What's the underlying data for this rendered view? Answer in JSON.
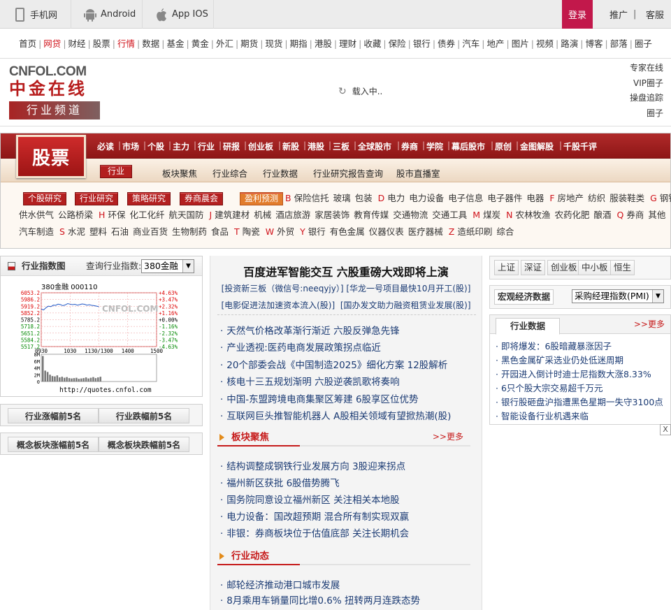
{
  "topbar": {
    "mobile": "手机网",
    "android": "Android",
    "ios": "App IOS",
    "login": "登录",
    "promote": "推广",
    "sep": "|",
    "service": "客服"
  },
  "nav": [
    "首页",
    "网贷",
    "财经",
    "股票",
    "行情",
    "数据",
    "基金",
    "黄金",
    "外汇",
    "期货",
    "现货",
    "期指",
    "港股",
    "理财",
    "收藏",
    "保险",
    "银行",
    "债券",
    "汽车",
    "地产",
    "图片",
    "视频",
    "路演",
    "博客",
    "部落",
    "圈子"
  ],
  "nav_red": [
    1,
    4
  ],
  "header": {
    "logo_top": "CNFOL.COM",
    "logo_mid": "中金在线",
    "logo_bottom": "行业频道",
    "loading": "载入中..",
    "side_links": [
      "专家在线",
      "VIP圈子",
      "操盘追踪",
      "圈子"
    ]
  },
  "band": {
    "title": "股票",
    "categories": [
      "必读",
      "市场",
      "个股",
      "主力",
      "行业",
      "研报",
      "创业板",
      "新股",
      "港股",
      "三板",
      "全球股市",
      "券商",
      "学院",
      "幕后股市",
      "原创",
      "金图解股",
      "千股千评"
    ],
    "active_sub": "行业",
    "subnav": [
      "板块聚焦",
      "行业综合",
      "行业数据",
      "行业研究报告查询",
      "股市直播室"
    ],
    "buttons": [
      "个股研究",
      "行业研究",
      "策略研究",
      "券商晨会"
    ],
    "orange_button": "盈利预测",
    "industry_lines": [
      [
        [
          "B",
          ""
        ],
        [
          "",
          "保险信托"
        ],
        [
          "",
          "玻璃"
        ],
        [
          "",
          "包装"
        ],
        [
          "D",
          ""
        ],
        [
          "",
          "电力"
        ],
        [
          "",
          "电力设备"
        ],
        [
          "",
          "电子信息"
        ],
        [
          "",
          "电子器件"
        ],
        [
          "",
          "电器"
        ],
        [
          "F",
          ""
        ],
        [
          "",
          "房地产"
        ],
        [
          "",
          "纺织"
        ],
        [
          "",
          "服装鞋类"
        ],
        [
          "G",
          ""
        ],
        [
          "",
          "钢铁"
        ]
      ],
      [
        [
          "",
          "供水供气"
        ],
        [
          "",
          "公路桥梁"
        ],
        [
          "H",
          ""
        ],
        [
          "",
          "环保"
        ],
        [
          "",
          "化工化纤"
        ],
        [
          "",
          "航天国防"
        ],
        [
          "J",
          ""
        ],
        [
          "",
          "建筑建材"
        ],
        [
          "",
          "机械"
        ],
        [
          "",
          "酒店旅游"
        ],
        [
          "",
          "家居装饰"
        ],
        [
          "",
          "教育传媒"
        ],
        [
          "",
          "交通物流"
        ],
        [
          "",
          "交通工具"
        ],
        [
          "M",
          ""
        ],
        [
          "",
          "煤炭"
        ],
        [
          "N",
          ""
        ],
        [
          "",
          "农林牧渔"
        ],
        [
          "",
          "农药化肥"
        ],
        [
          "",
          "酿酒"
        ],
        [
          "Q",
          ""
        ],
        [
          "",
          "券商"
        ],
        [
          "",
          "其他"
        ]
      ],
      [
        [
          "",
          "汽车制造"
        ],
        [
          "S",
          ""
        ],
        [
          "",
          "水泥"
        ],
        [
          "",
          "塑料"
        ],
        [
          "",
          "石油"
        ],
        [
          "",
          "商业百货"
        ],
        [
          "",
          "生物制药"
        ],
        [
          "",
          "食品"
        ],
        [
          "T",
          ""
        ],
        [
          "",
          "陶瓷"
        ],
        [
          "W",
          ""
        ],
        [
          "",
          "外贸"
        ],
        [
          "Y",
          ""
        ],
        [
          "",
          "银行"
        ],
        [
          "",
          "有色金属"
        ],
        [
          "",
          "仪器仪表"
        ],
        [
          "",
          "医疗器械"
        ],
        [
          "Z",
          ""
        ],
        [
          "",
          "造纸印刷"
        ],
        [
          "",
          "综合"
        ]
      ]
    ]
  },
  "left": {
    "index_title": "行业指数图",
    "query_label": "查询行业指数:",
    "query_value": "380金融",
    "chart_url": "http://quotes.cnfol.com",
    "gainers": "行业涨幅前5名",
    "losers": "行业跌幅前5名",
    "concept_gainers": "概念板块涨幅前5名",
    "concept_losers": "概念板块跌幅前5名"
  },
  "chart_data": {
    "type": "line",
    "title": "380金融  000110",
    "watermark": "CNFOL.COM 中金在线",
    "y_ticks_left": [
      "6053.2",
      "5986.2",
      "5919.2",
      "5852.2",
      "5785.2",
      "5718.2",
      "5651.2",
      "5584.2",
      "5517.2"
    ],
    "y_ticks_right": [
      "+4.63%",
      "+3.47%",
      "+2.32%",
      "+1.16%",
      "+0.00%",
      "-1.16%",
      "-2.32%",
      "-3.47%",
      "-4.63%"
    ],
    "x_ticks": [
      "0930",
      "1030",
      "1130/1300",
      "1400",
      "1500"
    ],
    "volume_ticks": [
      "8M",
      "6M",
      "4M",
      "2M",
      "0"
    ],
    "ylim": [
      5517.2,
      6053.2
    ],
    "x": [
      0,
      5,
      10,
      15,
      20,
      25,
      30,
      35,
      40,
      45,
      50,
      55,
      60,
      65,
      70,
      75,
      80,
      85,
      90,
      95,
      100,
      105,
      110,
      115,
      120
    ],
    "values": [
      5890,
      5882,
      5905,
      5920,
      5915,
      5930,
      5928,
      5940,
      5935,
      5925,
      5932,
      5945,
      5940,
      5935,
      5938,
      5930,
      5935,
      5942,
      5938,
      5930,
      5934,
      5928,
      5925,
      5920,
      5915
    ],
    "volume": [
      7.5,
      3.2,
      2.8,
      2.0,
      1.6,
      1.5,
      1.8,
      1.2,
      1.4,
      1.1,
      1.3,
      1.0,
      0.9,
      1.0,
      1.1,
      0.8,
      0.9,
      1.0,
      1.2,
      0.9,
      1.1,
      1.3,
      1.0,
      1.2,
      1.4
    ]
  },
  "middle": {
    "headline": "百度进军智能交互 六股重磅大戏即将上演",
    "sublinks1": [
      "[投资新三板（微信号:neeqyjy）]",
      "[华龙一号项目最快10月开工(股)]"
    ],
    "sublinks2": [
      "[电影促进法加速资本流入(股)]",
      "[国办发文助力融资租赁业发展(股)]"
    ],
    "news1": [
      "天然气价格改革渐行渐近 六股反弹急先锋",
      "产业透视:医药电商发展政策拐点临近",
      "20个部委会战《中国制造2025》细化方案 12股解析",
      "核电十三五规划渐明 六股逆袭凯歌将奏响",
      "中国-东盟跨境电商集聚区筹建 6股享区位优势",
      "互联网巨头推智能机器人 A股相关领域有望掀热潮(股)"
    ],
    "sec1": "板块聚焦",
    "more": ">>更多",
    "news2": [
      "结构调整成钢铁行业发展方向 3股迎来拐点",
      "福州新区获批 6股借势腾飞",
      "国务院同意设立福州新区 关注相关本地股",
      "电力设备：国改超预期 混合所有制实现双赢",
      "非银：券商板块位于估值底部 关注长期机会"
    ],
    "sec2": "行业动态",
    "news3": [
      "邮轮经济推动港口城市发展",
      "8月乘用车销量同比增0.6% 扭转两月连跌态势"
    ]
  },
  "right": {
    "market_tabs": [
      "上证",
      "深证",
      "创业板",
      "中小板",
      "恒生"
    ],
    "macro_label": "宏观经济数据",
    "macro_select": "采购经理指数(PMI)",
    "industry_tab": "行业数据",
    "more": ">>更多",
    "news": [
      "即将爆发：6股暗藏暴涨因子",
      "黑色金属矿采选业仍处低迷周期",
      "开园进入倒计时迪士尼指数大涨8.33%",
      "6只个股大宗交易超千万元",
      "银行股砸盘沪指遭黑色星期一失守3100点",
      "智能设备行业机遇来临"
    ],
    "close": "X"
  },
  "colors": {
    "brand_red": "#c61a1a",
    "login": "#c2184b",
    "link": "#1a3a73"
  }
}
